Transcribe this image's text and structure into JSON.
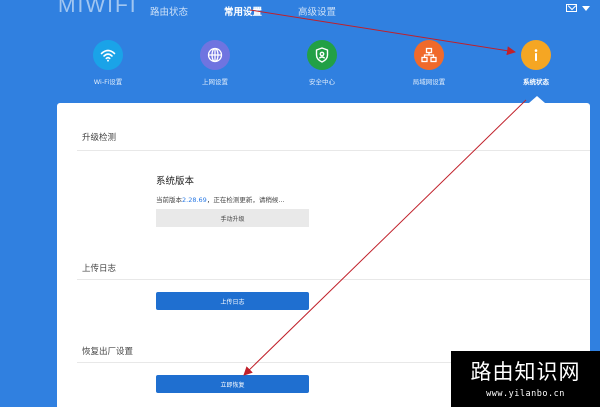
{
  "header": {
    "logo": "MIWIFI",
    "nav": [
      "路由状态",
      "常用设置",
      "高级设置"
    ],
    "active_nav": 1,
    "user": ""
  },
  "tools": [
    {
      "label": "Wi-Fi设置",
      "icon": "wifi-icon",
      "color": "#1aa3e8"
    },
    {
      "label": "上网设置",
      "icon": "globe-icon",
      "color": "#6f74e0"
    },
    {
      "label": "安全中心",
      "icon": "shield-icon",
      "color": "#22a045"
    },
    {
      "label": "局域网设置",
      "icon": "network-icon",
      "color": "#f06a2b"
    },
    {
      "label": "系统状态",
      "icon": "info-icon",
      "color": "#f5a623"
    }
  ],
  "active_tool": 4,
  "upgrade": {
    "section_title": "升级检测",
    "title": "系统版本",
    "status_prefix": "当前版本",
    "version": "2.28.69",
    "status_suffix": "，正在检测更新，请稍候...",
    "button": "手动升级"
  },
  "log": {
    "section_title": "上传日志",
    "button": "上传日志"
  },
  "reset": {
    "section_title": "恢复出厂设置",
    "button": "立即恢复"
  },
  "watermark": {
    "title": "路由知识网",
    "url": "www.yilanbo.cn"
  },
  "colors": {
    "background": "#3080e0",
    "primary_button": "#1f6fd0",
    "arrow": "#c0202a"
  }
}
